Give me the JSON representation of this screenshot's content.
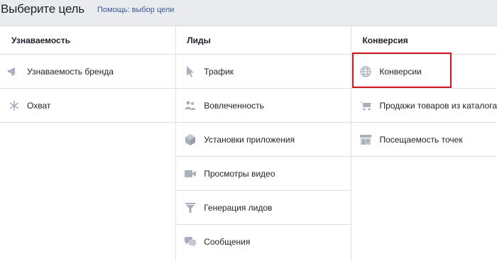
{
  "header": {
    "title": "Выберите цель",
    "help_link": "Помощь: выбор цели"
  },
  "columns": [
    {
      "heading": "Узнаваемость",
      "items": [
        {
          "label": "Узнаваемость бренда",
          "icon": "megaphone-icon"
        },
        {
          "label": "Охват",
          "icon": "snowflake-icon"
        }
      ]
    },
    {
      "heading": "Лиды",
      "items": [
        {
          "label": "Трафик",
          "icon": "cursor-icon"
        },
        {
          "label": "Вовлеченность",
          "icon": "people-icon"
        },
        {
          "label": "Установки приложения",
          "icon": "box-icon"
        },
        {
          "label": "Просмотры видео",
          "icon": "video-camera-icon"
        },
        {
          "label": "Генерация лидов",
          "icon": "funnel-icon"
        },
        {
          "label": "Сообщения",
          "icon": "chat-bubbles-icon"
        }
      ]
    },
    {
      "heading": "Конверсия",
      "items": [
        {
          "label": "Конверсии",
          "icon": "globe-icon",
          "highlighted": true
        },
        {
          "label": "Продажи товаров из каталога",
          "icon": "cart-icon"
        },
        {
          "label": "Посещаемость точек",
          "icon": "store-icon"
        }
      ]
    }
  ],
  "colors": {
    "icon": "#a9b0bd",
    "highlight_border": "#d0141f",
    "link": "#365899"
  }
}
